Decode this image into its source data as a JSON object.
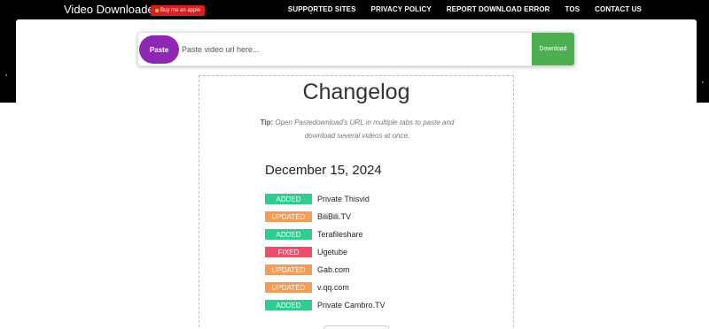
{
  "header": {
    "brand": "Video Downloader",
    "coffee_label": "Buy me an apple",
    "nav": [
      "SUPPORTED SITES",
      "PRIVACY POLICY",
      "REPORT DOWNLOAD ERROR",
      "TOS",
      "CONTACT US"
    ]
  },
  "search": {
    "paste_label": "Paste",
    "placeholder": "Paste video url here...",
    "download_label": "Download"
  },
  "changelog": {
    "title": "Changelog",
    "tip_label": "Tip:",
    "tip_text": "Open Pastedownload's URL in multiple tabs to paste and download several videos at once.",
    "date": "December 15, 2024",
    "entries": [
      {
        "status": "ADDED",
        "name": "Private Thisvid"
      },
      {
        "status": "UPDATED",
        "name": "BiliBili.TV"
      },
      {
        "status": "ADDED",
        "name": "Terafileshare"
      },
      {
        "status": "FIXED",
        "name": "Ugetube"
      },
      {
        "status": "UPDATED",
        "name": "Gab.com"
      },
      {
        "status": "UPDATED",
        "name": "v.qq.com"
      },
      {
        "status": "ADDED",
        "name": "Private Cambro.TV"
      }
    ]
  },
  "colors": {
    "added": "#2ecc8f",
    "updated": "#f39c5a",
    "fixed": "#ee4d6b",
    "paste": "#8e27b4",
    "download": "#4caf50"
  }
}
